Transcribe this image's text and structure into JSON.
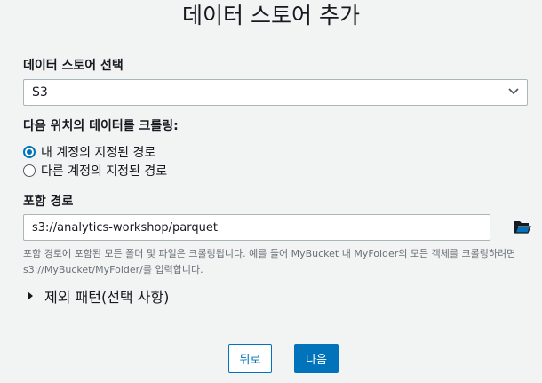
{
  "title": "데이터 스토어 추가",
  "datastore": {
    "label": "데이터 스토어 선택",
    "selected": "S3",
    "chevron_icon": "chevron-down-icon"
  },
  "crawl": {
    "label": "다음 위치의 데이터를 크롤링:",
    "options": [
      {
        "label": "내 계정의 지정된 경로",
        "checked": true
      },
      {
        "label": "다른 계정의 지정된 경로",
        "checked": false
      }
    ]
  },
  "include_path": {
    "label": "포함 경로",
    "value": "s3://analytics-workshop/parquet",
    "folder_icon": "folder-open-icon",
    "help": "포함 경로에 포함된 모든 폴더 및 파일은 크롤링됩니다. 예를 들어 MyBucket 내 MyFolder의 모든 객체를 크롤링하려면 s3://MyBucket/MyFolder/를 입력합니다."
  },
  "exclude": {
    "label": "제외 패턴(선택 사항)",
    "caret_icon": "caret-right-icon"
  },
  "buttons": {
    "back": "뒤로",
    "next": "다음"
  },
  "colors": {
    "accent": "#0073bb",
    "background": "#f2f3f3",
    "border": "#aab7b8",
    "muted_text": "#687078"
  }
}
